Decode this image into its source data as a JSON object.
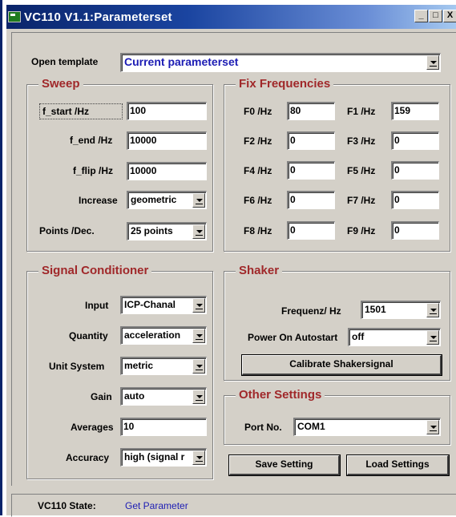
{
  "window": {
    "title": "VC110 V1.1:Parameterset",
    "minimize": "_",
    "maximize": "□",
    "close": "X"
  },
  "template": {
    "label": "Open template",
    "value": "Current parameterset"
  },
  "sweep": {
    "title": "Sweep",
    "f_start_label": "f_start /Hz",
    "f_start_value": "100",
    "f_end_label": "f_end /Hz",
    "f_end_value": "10000",
    "f_flip_label": "f_flip /Hz",
    "f_flip_value": "10000",
    "increase_label": "Increase",
    "increase_value": "geometric",
    "points_label": "Points /Dec.",
    "points_value": "25 points"
  },
  "fix": {
    "title": "Fix Frequencies",
    "items": [
      {
        "label": "F0 /Hz",
        "value": "80"
      },
      {
        "label": "F1 /Hz",
        "value": "159"
      },
      {
        "label": "F2 /Hz",
        "value": "0"
      },
      {
        "label": "F3 /Hz",
        "value": "0"
      },
      {
        "label": "F4 /Hz",
        "value": "0"
      },
      {
        "label": "F5 /Hz",
        "value": "0"
      },
      {
        "label": "F6 /Hz",
        "value": "0"
      },
      {
        "label": "F7 /Hz",
        "value": "0"
      },
      {
        "label": "F8 /Hz",
        "value": "0"
      },
      {
        "label": "F9 /Hz",
        "value": "0"
      }
    ]
  },
  "signal": {
    "title": "Signal Conditioner",
    "input_label": "Input",
    "input_value": "ICP-Chanal",
    "quantity_label": "Quantity",
    "quantity_value": "acceleration",
    "unit_label": "Unit System",
    "unit_value": "metric",
    "gain_label": "Gain",
    "gain_value": "auto",
    "averages_label": "Averages",
    "averages_value": "10",
    "accuracy_label": "Accuracy",
    "accuracy_value": "high (signal r"
  },
  "shaker": {
    "title": "Shaker",
    "freq_label": "Frequenz/ Hz",
    "freq_value": "1501",
    "power_label": "Power On Autostart",
    "power_value": "off",
    "calibrate_label": "Calibrate Shakersignal"
  },
  "other": {
    "title": "Other Settings",
    "port_label": "Port No.",
    "port_value": "COM1"
  },
  "buttons": {
    "save": "Save Setting",
    "load": "Load Settings"
  },
  "status": {
    "label": "VC110 State:",
    "value": "Get Parameter"
  },
  "colors": {
    "legend": "#a0282a",
    "status_value": "#1c1cb4",
    "template_value": "#1c1cb4",
    "face": "#d4d0c8"
  }
}
